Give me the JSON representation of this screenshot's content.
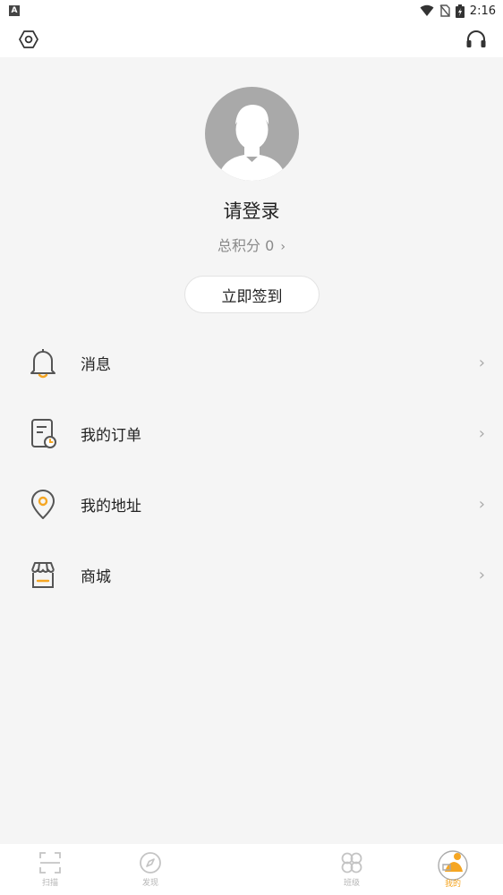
{
  "status_bar": {
    "left_badge": "A",
    "time": "2:16",
    "icons": [
      "wifi-icon",
      "no-sim-icon",
      "battery-charging-icon"
    ]
  },
  "app_bar": {
    "left_icon": "settings-hex-icon",
    "right_icon": "headset-icon"
  },
  "profile": {
    "login_text": "请登录",
    "points_text": "总积分 0",
    "points_chevron": "›",
    "checkin_label": "立即签到"
  },
  "menu": {
    "items": [
      {
        "label": "消息",
        "icon": "bell-icon"
      },
      {
        "label": "我的订单",
        "icon": "order-icon"
      },
      {
        "label": "我的地址",
        "icon": "location-pin-icon"
      },
      {
        "label": "商城",
        "icon": "store-icon"
      }
    ],
    "arrow": "›"
  },
  "bottom_nav": {
    "items": [
      {
        "label": "扫描",
        "icon": "scan-icon"
      },
      {
        "label": "发现",
        "icon": "compass-icon"
      },
      {
        "label": "班级",
        "icon": "clover-icon"
      },
      {
        "label": "我的",
        "icon": "profile-tab-icon"
      }
    ]
  },
  "colors": {
    "accent": "#f5a623",
    "background": "#f5f5f5",
    "avatar": "#a9a9a9"
  }
}
